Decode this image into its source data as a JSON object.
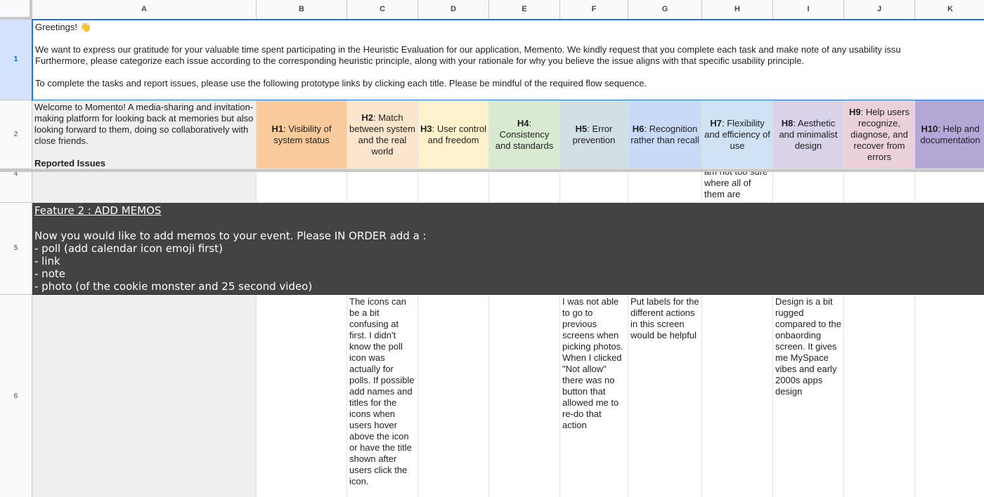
{
  "columns": [
    "A",
    "B",
    "C",
    "D",
    "E",
    "F",
    "G",
    "H",
    "I",
    "J",
    "K"
  ],
  "rows": [
    "1",
    "2",
    "4",
    "5",
    "6"
  ],
  "intro": {
    "greeting": "Greetings! 👋",
    "line1": "We want to express our gratitude for your valuable time spent participating in the Heuristic Evaluation for our application, Memento. We kindly request that you complete each task and make note of any usability issu",
    "line2": "Furthermore, please categorize each issue according to the corresponding heuristic principle, along with your rationale for why you believe the issue aligns with that specific usability principle.",
    "line3": "To complete the tasks and report issues, please use the following prototype links by clicking each title. Please be mindful of the required flow sequence."
  },
  "welcome": {
    "text": "Welcome to Momento! A media-sharing and invitation-making platform for looking back at memories but also looking forward to them, doing so collaboratively with close friends.",
    "reported": "Reported Issues"
  },
  "heuristics": [
    {
      "code": "H1",
      "label": ": Visibility of system status",
      "color": "#f9cb9c"
    },
    {
      "code": "H2",
      "label": ": Match between system and the real world",
      "color": "#fce5cd"
    },
    {
      "code": "H3",
      "label": ": User control and freedom",
      "color": "#fff2cc"
    },
    {
      "code": "H4",
      "label": ": Consistency and standards",
      "color": "#d9ead3"
    },
    {
      "code": "H5",
      "label": ": Error prevention",
      "color": "#d0e0e3"
    },
    {
      "code": "H6",
      "label": ": Recognition rather than recall",
      "color": "#c9daf8"
    },
    {
      "code": "H7",
      "label": ": Flexibility and efficiency of use",
      "color": "#cfe2f3"
    },
    {
      "code": "H8",
      "label": ": Aesthetic and minimalist design",
      "color": "#d9d2e9"
    },
    {
      "code": "H9",
      "label": ": Help users recognize, diagnose, and recover from errors",
      "color": "#ead1dc"
    },
    {
      "code": "H10",
      "label": ": Help and documentation",
      "color": "#b4a7d6"
    }
  ],
  "row4": {
    "h7": "am not too sure where all of them are"
  },
  "feature2": {
    "title": "Feature 2 : ADD MEMOS",
    "instruction": "Now you would like to add memos to your event. Please IN ORDER add a :",
    "items": [
      "- poll (add calendar icon emoji first)",
      "- link",
      "- note",
      "- photo (of the cookie monster and 25 second video)"
    ]
  },
  "row6": {
    "h2": "The icons can be a bit confusing at first. I didn't know the poll icon was actually for polls. If possible add names and titles for the icons when users hover above the icon or have the title shown after users click the icon.",
    "h5": "I was not able to go to previous screens when picking photos. When I clicked \"Not allow\" there was no button that allowed me to re-do that action",
    "h6": "Put labels for the different actions in this screen would be helpful",
    "h8": "Design is a bit rugged compared to the onbaording screen. It gives me MySpace vibes and early 2000s apps design"
  },
  "colors": {
    "selection": "#1a73e8",
    "featureBg": "#434343",
    "colA": "#efefef"
  }
}
